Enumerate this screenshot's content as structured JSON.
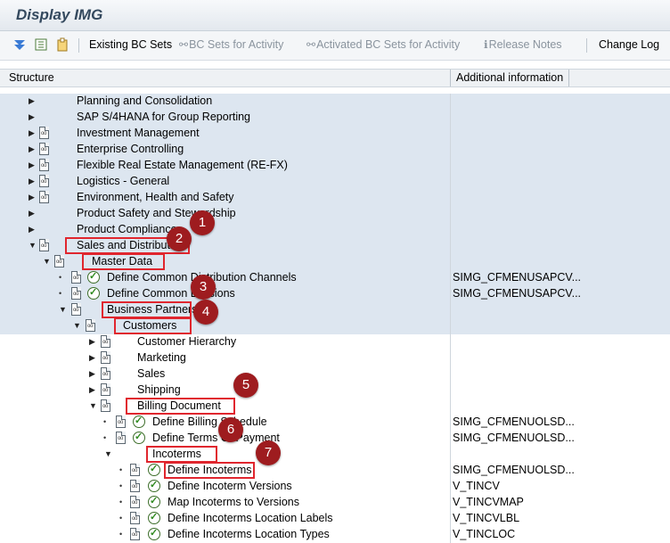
{
  "window": {
    "title": "Display IMG"
  },
  "toolbar": {
    "existing_bc_sets": "Existing BC Sets",
    "bc_sets_for_activity": "BC Sets for Activity",
    "activated_bc_sets": "Activated BC Sets for Activity",
    "release_notes": "Release Notes",
    "change_log": "Change Log"
  },
  "columns": {
    "structure": "Structure",
    "additional_info": "Additional information"
  },
  "tree": [
    {
      "label": "Planning and Consolidation",
      "info": "",
      "toggle": "collapsed",
      "icon": "none",
      "selected": true
    },
    {
      "label": "SAP S/4HANA for Group Reporting",
      "info": "",
      "toggle": "collapsed",
      "icon": "none",
      "selected": true
    },
    {
      "label": "Investment Management",
      "info": "",
      "toggle": "collapsed",
      "icon": "doc",
      "selected": true
    },
    {
      "label": "Enterprise Controlling",
      "info": "",
      "toggle": "collapsed",
      "icon": "doc",
      "selected": true
    },
    {
      "label": "Flexible Real Estate Management (RE-FX)",
      "info": "",
      "toggle": "collapsed",
      "icon": "doc",
      "selected": true
    },
    {
      "label": "Logistics - General",
      "info": "",
      "toggle": "collapsed",
      "icon": "doc",
      "selected": true
    },
    {
      "label": "Environment, Health and Safety",
      "info": "",
      "toggle": "collapsed",
      "icon": "doc",
      "selected": true
    },
    {
      "label": "Product Safety and Stewardship",
      "info": "",
      "toggle": "collapsed",
      "icon": "none",
      "selected": true
    },
    {
      "label": "Product Compliance",
      "info": "",
      "toggle": "collapsed",
      "icon": "none",
      "selected": true
    },
    {
      "label": "Sales and Distribution",
      "info": "",
      "toggle": "expanded",
      "icon": "doc",
      "selected": true,
      "callout": "1"
    },
    {
      "label": "Master Data",
      "info": "",
      "toggle": "expanded",
      "icon": "doc",
      "selected": true,
      "callout": "2"
    },
    {
      "label": "Define Common Distribution Channels",
      "info": "SIMG_CFMENUSAPCV...",
      "toggle": "leaf",
      "icon": "doc-clock",
      "selected": true
    },
    {
      "label": "Define Common Divisions",
      "info": "SIMG_CFMENUSAPCV...",
      "toggle": "leaf",
      "icon": "doc-clock",
      "selected": true
    },
    {
      "label": "Business Partners",
      "info": "",
      "toggle": "expanded",
      "icon": "doc",
      "selected": true,
      "callout": "3"
    },
    {
      "label": "Customers",
      "info": "",
      "toggle": "expanded",
      "icon": "doc",
      "selected": true,
      "callout": "4"
    },
    {
      "label": "Customer Hierarchy",
      "info": "",
      "toggle": "collapsed",
      "icon": "doc",
      "selected": false
    },
    {
      "label": "Marketing",
      "info": "",
      "toggle": "collapsed",
      "icon": "doc",
      "selected": false
    },
    {
      "label": "Sales",
      "info": "",
      "toggle": "collapsed",
      "icon": "doc",
      "selected": false
    },
    {
      "label": "Shipping",
      "info": "",
      "toggle": "collapsed",
      "icon": "doc",
      "selected": false
    },
    {
      "label": "Billing Document",
      "info": "",
      "toggle": "expanded",
      "icon": "doc",
      "selected": false,
      "callout": "5"
    },
    {
      "label": "Define Billing Schedule",
      "info": "SIMG_CFMENUOLSD...",
      "toggle": "leaf",
      "icon": "doc-clock",
      "selected": false
    },
    {
      "label": "Define Terms Of Payment",
      "info": "SIMG_CFMENUOLSD...",
      "toggle": "leaf",
      "icon": "doc-clock",
      "selected": false
    },
    {
      "label": "Incoterms",
      "info": "",
      "toggle": "expanded",
      "icon": "none",
      "selected": false,
      "callout": "6"
    },
    {
      "label": "Define Incoterms",
      "info": "SIMG_CFMENUOLSD...",
      "toggle": "leaf",
      "icon": "doc-clock",
      "selected": false,
      "callout": "7"
    },
    {
      "label": "Define Incoterm Versions",
      "info": "V_TINCV",
      "toggle": "leaf",
      "icon": "doc-clock",
      "selected": false
    },
    {
      "label": "Map Incoterms to Versions",
      "info": "V_TINCVMAP",
      "toggle": "leaf",
      "icon": "doc-clock",
      "selected": false
    },
    {
      "label": "Define Incoterms Location Labels",
      "info": "V_TINCVLBL",
      "toggle": "leaf",
      "icon": "doc-clock",
      "selected": false
    },
    {
      "label": "Define Incoterms Location Types",
      "info": "V_TINCLOC",
      "toggle": "leaf",
      "icon": "doc-clock",
      "selected": false
    }
  ],
  "colors": {
    "selected_row": "#dde6f0",
    "highlight_box": "#e0262e",
    "callout_badge": "#9e1c1f"
  }
}
